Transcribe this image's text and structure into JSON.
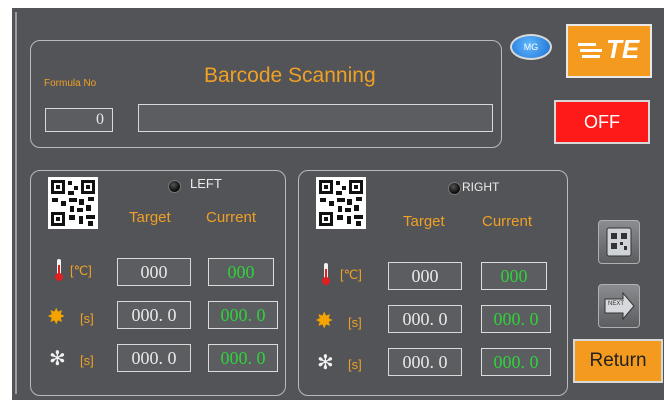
{
  "header": {
    "formula_label": "Formula No",
    "title": "Barcode Scanning",
    "formula_value": "0",
    "barcode_value": ""
  },
  "badge": {
    "label": "MG"
  },
  "logo": {
    "text": "TE"
  },
  "off_button": {
    "label": "OFF",
    "color": "#ff1a1a"
  },
  "left": {
    "label": "LEFT",
    "target_header": "Target",
    "current_header": "Current",
    "temp_unit": "[℃]",
    "sec_unit": "[s]",
    "temp_target": "000",
    "temp_current": "000",
    "heat_target": "000. 0",
    "heat_current": "000. 0",
    "cool_target": "000. 0",
    "cool_current": "000. 0"
  },
  "right": {
    "label": "RIGHT",
    "target_header": "Target",
    "current_header": "Current",
    "temp_unit": "[℃]",
    "sec_unit": "[s]",
    "temp_target": "000",
    "temp_current": "000",
    "heat_target": "000. 0",
    "heat_current": "000. 0",
    "cool_target": "000. 0",
    "cool_current": "000. 0"
  },
  "next_button": {
    "label": "NEXT"
  },
  "return_button": {
    "label": "Return"
  },
  "colors": {
    "accent": "#f0a024",
    "value_green": "#2fd23a",
    "background": "#525458"
  }
}
